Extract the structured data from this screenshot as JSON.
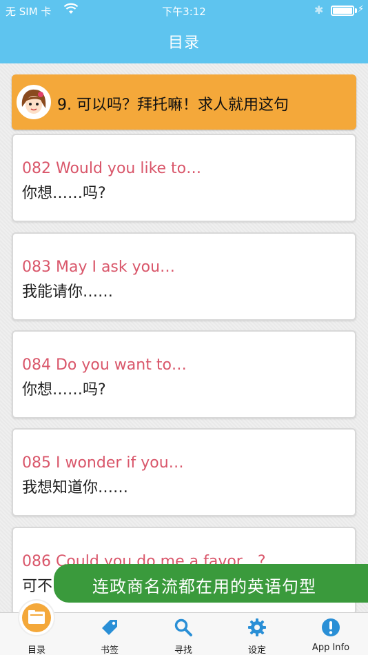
{
  "status": {
    "carrier": "无 SIM 卡",
    "time": "下午3:12",
    "bluetooth_symbol": "✱",
    "charging_symbol": "⚡"
  },
  "nav": {
    "title": "目录"
  },
  "section": {
    "title": "9. 可以吗？拜托嘛！求人就用这句"
  },
  "items": [
    {
      "en": "082 Would you like to…",
      "zh": "你想……吗?"
    },
    {
      "en": "083 May I ask you…",
      "zh": "我能请你……"
    },
    {
      "en": "084 Do you want to…",
      "zh": "你想……吗?"
    },
    {
      "en": "085 I wonder if you…",
      "zh": "我想知道你……"
    },
    {
      "en": "086 Could you do me a favor…?",
      "zh": "可不……"
    }
  ],
  "banner": {
    "text": "连政商名流都在用的英语句型"
  },
  "tabs": [
    {
      "label": "目录",
      "icon": "folder-icon",
      "active": true
    },
    {
      "label": "书签",
      "icon": "tag-icon"
    },
    {
      "label": "寻找",
      "icon": "search-icon"
    },
    {
      "label": "设定",
      "icon": "gear-icon"
    },
    {
      "label": "App Info",
      "icon": "info-icon"
    }
  ],
  "colors": {
    "accent_blue": "#5ec4ef",
    "section_orange": "#f4a83a",
    "english_red": "#d9566a",
    "banner_green": "#3a9a3c"
  }
}
